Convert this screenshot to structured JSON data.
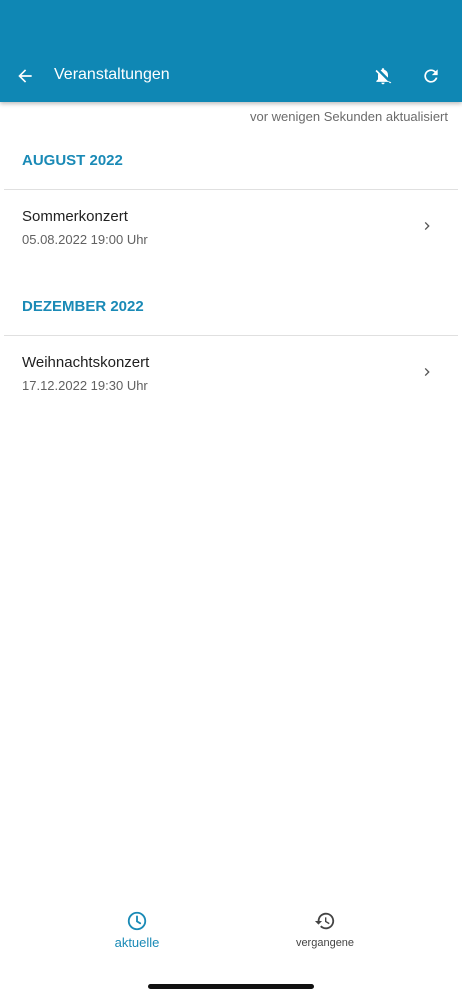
{
  "header": {
    "title": "Veranstaltungen",
    "back_icon": "arrow-left-icon",
    "notify_icon": "bell-off-icon",
    "refresh_icon": "refresh-icon",
    "background": "#0f87b4"
  },
  "status": {
    "updated_text": "vor wenigen Sekunden aktualisiert"
  },
  "sections": [
    {
      "heading": "AUGUST 2022",
      "events": [
        {
          "name": "Sommerkonzert",
          "date": "05.08.2022 19:00 Uhr"
        }
      ]
    },
    {
      "heading": "DEZEMBER 2022",
      "events": [
        {
          "name": "Weihnachtskonzert",
          "date": "17.12.2022 19:30 Uhr"
        }
      ]
    }
  ],
  "bottom_nav": {
    "items": [
      {
        "label": "aktuelle",
        "icon": "clock-icon",
        "active": true
      },
      {
        "label": "vergangene",
        "icon": "history-icon",
        "active": false
      }
    ],
    "accent": "#1a8ab6"
  }
}
